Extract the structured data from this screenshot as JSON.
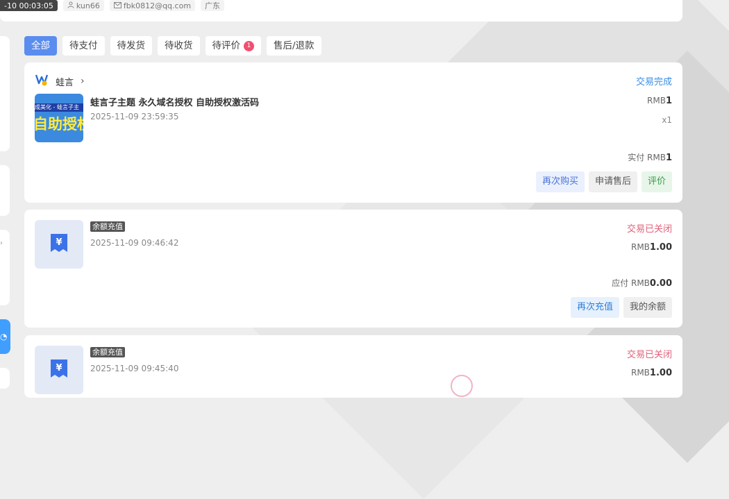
{
  "header": {
    "time": "-10 00:03:05",
    "user": "kun66",
    "email": "fbk0812@qq.com",
    "region": "广东"
  },
  "tabs": [
    {
      "label": "全部",
      "active": true
    },
    {
      "label": "待支付"
    },
    {
      "label": "待发货"
    },
    {
      "label": "待收货"
    },
    {
      "label": "待评价",
      "badge": "1"
    },
    {
      "label": "售后/退款"
    }
  ],
  "orders": [
    {
      "shop": "蛙言",
      "status": "交易完成",
      "title": "蛙言子主题 永久域名授权 自助授权激活码",
      "date": "2025-11-09 23:59:35",
      "thumb_band": "成美化 - 蛙言子主",
      "thumb_big": "自助授权",
      "currency": "RMB",
      "price": "1",
      "qty": "x1",
      "paid_label": "实付 RMB",
      "paid_value": "1",
      "actions": [
        "再次购买",
        "申请售后",
        "评价"
      ]
    },
    {
      "tag": "余额充值",
      "status": "交易已关闭",
      "date": "2025-11-09 09:46:42",
      "currency": "RMB",
      "price": "1.00",
      "due_label": "应付 RMB",
      "due_value": "0.00",
      "actions": [
        "再次充值",
        "我的余额"
      ]
    },
    {
      "tag": "余额充值",
      "status": "交易已关闭",
      "date": "2025-11-09 09:45:40",
      "currency": "RMB",
      "price": "1.00"
    }
  ],
  "icons": {
    "user": "user-icon",
    "mail": "mail-icon",
    "chevron": "chevron-right-icon",
    "yuan": "yuan-receipt-icon"
  }
}
